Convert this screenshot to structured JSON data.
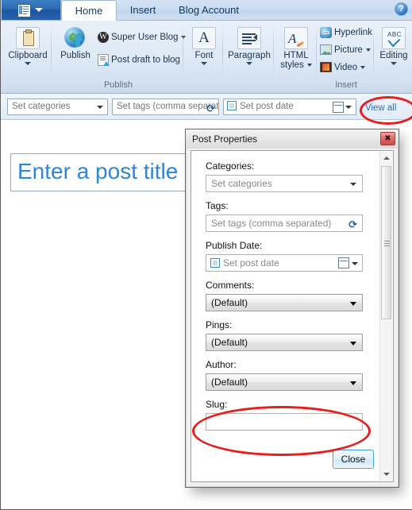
{
  "window": {
    "quick_access": {
      "icon": "document-menu-icon",
      "caret": "chevron-down-icon"
    },
    "help_icon": "help-icon",
    "help_glyph": "?"
  },
  "tabs": [
    {
      "label": "Home",
      "active": true
    },
    {
      "label": "Insert",
      "active": false
    },
    {
      "label": "Blog Account",
      "active": false
    }
  ],
  "ribbon": {
    "groups": [
      {
        "name": "clipboard",
        "label": ""
      },
      {
        "name": "publish",
        "label": "Publish"
      },
      {
        "name": "font",
        "label": ""
      },
      {
        "name": "paragraph",
        "label": ""
      },
      {
        "name": "html-styles",
        "label": ""
      },
      {
        "name": "insert",
        "label": "Insert"
      },
      {
        "name": "editing",
        "label": ""
      }
    ],
    "clipboard": {
      "label": "Clipboard",
      "icon": "clipboard-icon"
    },
    "publish": {
      "group_label": "Publish",
      "publish_label": "Publish",
      "publish_icon": "publish-globe-icon",
      "blog_label": "Super User Blog",
      "blog_icon": "wordpress-icon",
      "draft_label": "Post draft to blog",
      "draft_icon": "post-draft-icon"
    },
    "font": {
      "label": "Font",
      "icon": "font-a-icon"
    },
    "paragraph": {
      "label": "Paragraph",
      "icon": "paragraph-icon"
    },
    "html_styles": {
      "label_line1": "HTML",
      "label_line2": "styles",
      "icon": "html-styles-icon"
    },
    "insert": {
      "group_label": "Insert",
      "hyperlink_label": "Hyperlink",
      "hyperlink_icon": "hyperlink-icon",
      "picture_label": "Picture",
      "picture_icon": "picture-icon",
      "video_label": "Video",
      "video_icon": "video-icon"
    },
    "editing": {
      "label": "Editing",
      "icon": "spell-check-icon"
    }
  },
  "properties_bar": {
    "categories_value": "Set categories",
    "tags_value": "Set tags (comma separated)",
    "tags_refresh_icon": "refresh-tags-icon",
    "post_date_value": "Set post date",
    "post_date_checkbox": "post-date-checkbox",
    "calendar_icon": "calendar-icon",
    "view_all_label": "View all"
  },
  "editor": {
    "post_title_placeholder": "Enter a post title",
    "post_title_color": "#2f86d6"
  },
  "dialog": {
    "title": "Post Properties",
    "close_icon": "close-icon",
    "close_glyph": "✖",
    "fields": [
      {
        "label": "Categories:",
        "type": "combo-placeholder",
        "value": "Set categories"
      },
      {
        "label": "Tags:",
        "type": "input-placeholder",
        "value": "Set tags (comma separated)"
      },
      {
        "label": "Publish Date:",
        "type": "date",
        "value": "Set post date"
      },
      {
        "label": "Comments:",
        "type": "combo",
        "value": "(Default)"
      },
      {
        "label": "Pings:",
        "type": "combo",
        "value": "(Default)"
      },
      {
        "label": "Author:",
        "type": "combo",
        "value": "(Default)"
      },
      {
        "label": "Slug:",
        "type": "input",
        "value": ""
      }
    ],
    "close_button_label": "Close",
    "scrollbar": {
      "up_icon": "scroll-up-icon",
      "down_icon": "scroll-down-icon",
      "thumb": "scroll-thumb"
    }
  },
  "annotations": {
    "highlight_color": "#e81d1d",
    "ellipses": [
      {
        "name": "view-all-highlight"
      },
      {
        "name": "slug-field-highlight"
      }
    ]
  }
}
